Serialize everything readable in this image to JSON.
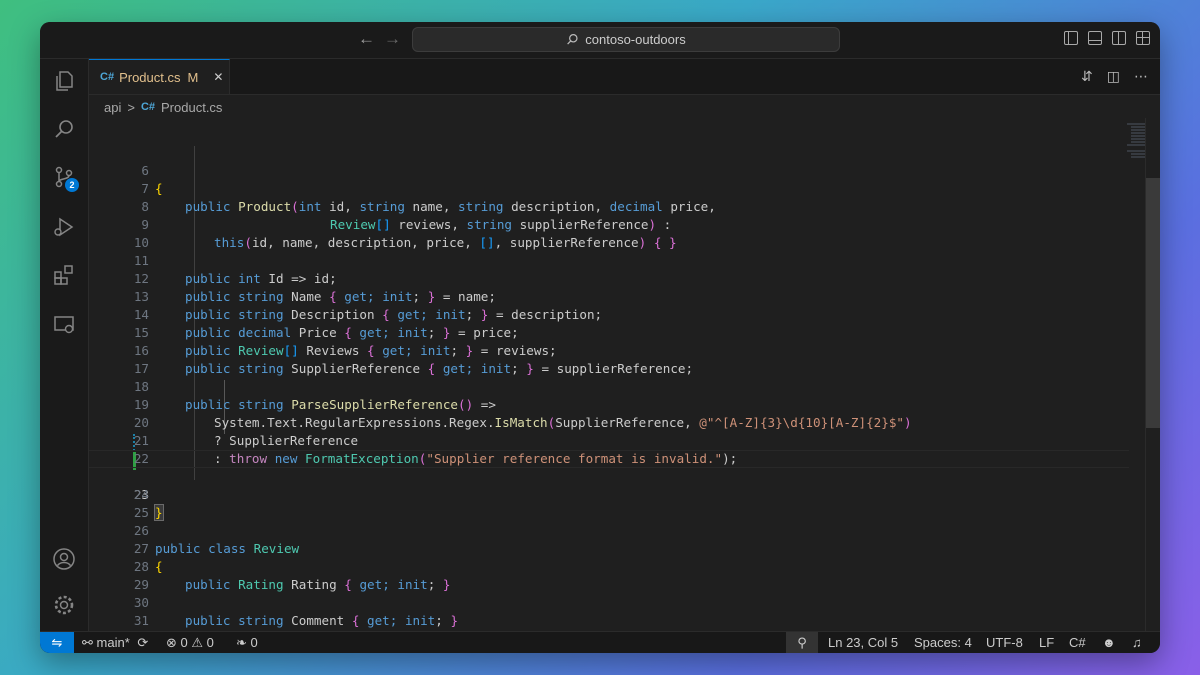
{
  "titlebar": {
    "search_text": "contoso-outdoors",
    "back_icon": "arrow-left-icon",
    "forward_icon": "arrow-right-icon"
  },
  "tab": {
    "label": "Product.cs",
    "modified": "M",
    "close": "✕"
  },
  "breadcrumb": {
    "folder": "api",
    "separator": ">",
    "file": "Product.cs"
  },
  "activity": {
    "scm_badge": "2"
  },
  "status": {
    "branch": "main*",
    "errors": "0",
    "warnings": "0",
    "ports": "0",
    "position": "Ln 23, Col 5",
    "spaces": "Spaces: 4",
    "encoding": "UTF-8",
    "eol": "LF",
    "language": "C#"
  },
  "code": {
    "lines": [
      {
        "n": "6"
      },
      {
        "n": "7"
      },
      {
        "n": "8"
      },
      {
        "n": "9"
      },
      {
        "n": "10"
      },
      {
        "n": "11"
      },
      {
        "n": "12"
      },
      {
        "n": "13"
      },
      {
        "n": "14"
      },
      {
        "n": "15"
      },
      {
        "n": "16"
      },
      {
        "n": "17"
      },
      {
        "n": "18"
      },
      {
        "n": "19"
      },
      {
        "n": "20"
      },
      {
        "n": "21"
      },
      {
        "n": "22"
      },
      {
        "n": "23"
      },
      {
        "n": "24"
      },
      {
        "n": "25"
      },
      {
        "n": "26"
      },
      {
        "n": "27"
      },
      {
        "n": "28"
      },
      {
        "n": "29"
      },
      {
        "n": "30"
      },
      {
        "n": "31"
      }
    ],
    "t": {
      "l7_a": "public",
      "l7_b": "Product",
      "l7_c": "(",
      "l7_d": "int",
      "l7_e": " id, ",
      "l7_f": "string",
      "l7_g": " name, ",
      "l7_h": "string",
      "l7_i": " description, ",
      "l7_j": "decimal",
      "l7_k": " price,",
      "l8_a": "Review",
      "l8_b": "[]",
      "l8_c": " reviews, ",
      "l8_d": "string",
      "l8_e": " supplierReference",
      "l8_f": ")",
      "l8_g": " :",
      "l9_a": "this",
      "l9_b": "(",
      "l9_c": "id, name, description, price, ",
      "l9_d": "[]",
      "l9_e": ", supplierReference",
      "l9_f": ")",
      "l9_g": " ",
      "l9_h": "{ }",
      "l11_a": "public",
      "l11_b": "int",
      "l11_c": " Id => id;",
      "l12_a": "public",
      "l12_b": "string",
      "l12_c": " Name ",
      "l12_d": "{",
      "l12_e": " get; ",
      "l12_f": "init",
      "l12_g": "; ",
      "l12_h": "}",
      "l12_i": " = name;",
      "l13_a": "public",
      "l13_b": "string",
      "l13_c": " Description ",
      "l13_d": "{",
      "l13_e": " get; ",
      "l13_f": "init",
      "l13_g": "; ",
      "l13_h": "}",
      "l13_i": " = description;",
      "l14_a": "public",
      "l14_b": "decimal",
      "l14_c": " Price ",
      "l14_d": "{",
      "l14_e": " get; ",
      "l14_f": "init",
      "l14_g": "; ",
      "l14_h": "}",
      "l14_i": " = price;",
      "l15_a": "public",
      "l15_b": "Review",
      "l15_c": "[]",
      "l15_d": " Reviews ",
      "l15_e": "{",
      "l15_f": " get; ",
      "l15_g": "init",
      "l15_h": "; ",
      "l15_i": "}",
      "l15_j": " = reviews;",
      "l16_a": "public",
      "l16_b": "string",
      "l16_c": " SupplierReference ",
      "l16_d": "{",
      "l16_e": " get; ",
      "l16_f": "init",
      "l16_g": "; ",
      "l16_h": "}",
      "l16_i": " = supplierReference;",
      "l18_a": "public",
      "l18_b": "string",
      "l18_c": " ",
      "l18_d": "ParseSupplierReference",
      "l18_e": "()",
      "l18_f": " =>",
      "l19_a": "System.Text.RegularExpressions.Regex.",
      "l19_b": "IsMatch",
      "l19_c": "(",
      "l19_d": "SupplierReference, ",
      "l19_e": "@\"^[A-Z]{3}\\d{10}[A-Z]{2}$\"",
      "l19_f": ")",
      "l20_a": "? SupplierReference",
      "l21_a": ": ",
      "l21_b": "throw",
      "l21_c": " ",
      "l21_d": "new",
      "l21_e": " ",
      "l21_f": "FormatException",
      "l21_g": "(",
      "l21_h": "\"Supplier reference format is invalid.\"",
      "l21_i": ");",
      "l24_a": "}",
      "l26_a": "public",
      "l26_b": " ",
      "l26_c": "class",
      "l26_d": " ",
      "l26_e": "Review",
      "l27_a": "{",
      "l28_a": "public",
      "l28_b": " ",
      "l28_c": "Rating",
      "l28_d": " Rating ",
      "l28_e": "{",
      "l28_f": " get; ",
      "l28_g": "init",
      "l28_h": "; ",
      "l28_i": "}",
      "l30_a": "public",
      "l30_b": " ",
      "l30_c": "string",
      "l30_d": " Comment ",
      "l30_e": "{",
      "l30_f": " get; ",
      "l30_g": "init",
      "l30_h": "; ",
      "l30_i": "}",
      "l31_a": "}",
      "l6_a": "{"
    }
  },
  "colors": {
    "accent": "#0078d4",
    "modified": "#e2c08d"
  }
}
